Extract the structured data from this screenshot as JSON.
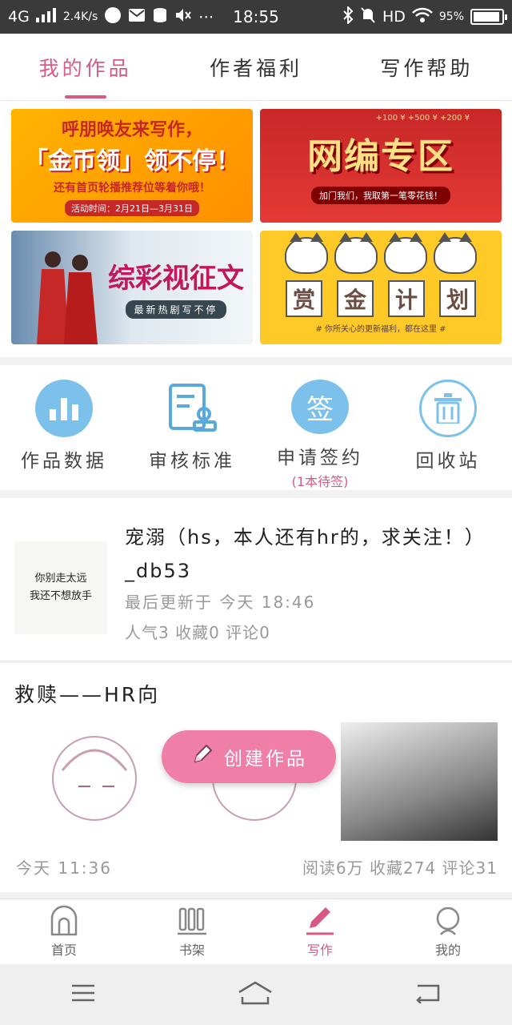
{
  "status_bar": {
    "network": "4G",
    "speed": "2.4K/s",
    "time": "18:55",
    "hd": "HD",
    "battery_text": "95%",
    "battery_level": 0.95
  },
  "top_tabs": [
    {
      "label": "我的作品",
      "active": true
    },
    {
      "label": "作者福利",
      "active": false
    },
    {
      "label": "写作帮助",
      "active": false
    }
  ],
  "banners": {
    "b1": {
      "line1": "呼朋唤友来写作，",
      "line2": "「金币领」领不停！",
      "line3": "还有首页轮播推荐位等着你哦！",
      "line4": "活动时间：2月21日—3月31日"
    },
    "b2": {
      "line1": "网编专区",
      "line2": "加门我们，我取第一笔零花钱！",
      "coins": "+100 ¥  +500 ¥  +200 ¥"
    },
    "b3": {
      "line1": "综彩视征文",
      "line2": "最新热剧写不停"
    },
    "b4": {
      "chars": [
        "赏",
        "金",
        "计",
        "划"
      ],
      "line2": "# 你所关心的更新福利，都在这里 #"
    }
  },
  "tools": [
    {
      "label": "作品数据",
      "icon": "bar-chart-icon"
    },
    {
      "label": "审核标准",
      "icon": "document-stamp-icon"
    },
    {
      "label": "申请签约",
      "icon": "sign-icon",
      "icon_text": "签",
      "sub": "(1本待签)"
    },
    {
      "label": "回收站",
      "icon": "trash-icon"
    }
  ],
  "work1": {
    "cover_line1": "你别走太远",
    "cover_line2": "我还不想放手",
    "title": "宠溺（hs，本人还有hr的，求关注！）_db53",
    "updated": "最后更新于 今天 18:46",
    "stats": "人气3 收藏0 评论0"
  },
  "work2": {
    "title": "救赎——HR向",
    "time": "今天 11:36",
    "stats": "阅读6万 收藏274 评论31"
  },
  "create_button": {
    "label": "创建作品"
  },
  "bottom_nav": [
    {
      "label": "首页",
      "icon": "home-icon",
      "active": false
    },
    {
      "label": "书架",
      "icon": "bookshelf-icon",
      "active": false
    },
    {
      "label": "写作",
      "icon": "pen-icon",
      "active": true
    },
    {
      "label": "我的",
      "icon": "profile-icon",
      "active": false
    }
  ],
  "colors": {
    "accent": "#d85a82",
    "button": "#f07fa8",
    "tool_blue": "#7cc0ec"
  }
}
